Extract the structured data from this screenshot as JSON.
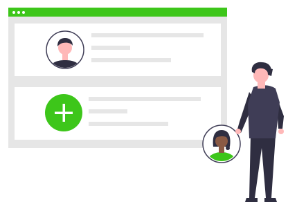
{
  "colors": {
    "accent": "#3dc61a",
    "window_frame": "#e6e6e6",
    "card_bg": "#ffffff",
    "placeholder_line": "#e6e6e6",
    "dark": "#2f2e41",
    "skin": "#ffb8b8"
  },
  "window": {
    "titlebar_dots": [
      "dot",
      "dot",
      "dot"
    ],
    "cards": [
      {
        "icon": "user-avatar-icon",
        "placeholder_lines": 3
      },
      {
        "icon": "plus-icon",
        "placeholder_lines": 3
      }
    ]
  },
  "illustration": {
    "person": "standing-man-figure",
    "badge": "user-avatar-icon"
  }
}
